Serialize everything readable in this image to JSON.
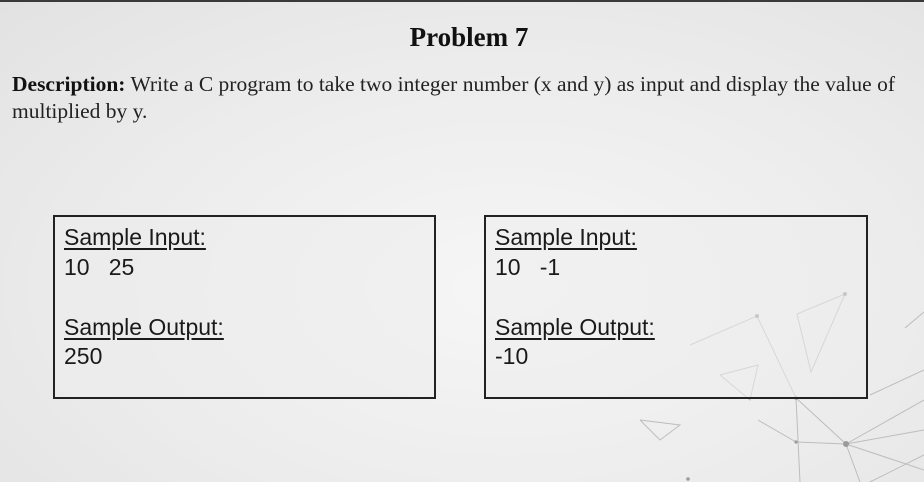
{
  "problem": {
    "title": "Problem 7",
    "description_label": "Description:",
    "description_line1": " Write a C program to take two integer number (x and y) as input and display the value of",
    "description_line2": "multiplied by y."
  },
  "samples": [
    {
      "input_heading": "Sample Input:",
      "input_value": "10   25",
      "output_heading": "Sample Output:",
      "output_value": "250"
    },
    {
      "input_heading": "Sample Input:",
      "input_value": "10   -1",
      "output_heading": "Sample Output:",
      "output_value": "-10"
    }
  ],
  "colors": {
    "background": "#ececec",
    "border": "#222222",
    "decoration": "#b5b5b5"
  }
}
